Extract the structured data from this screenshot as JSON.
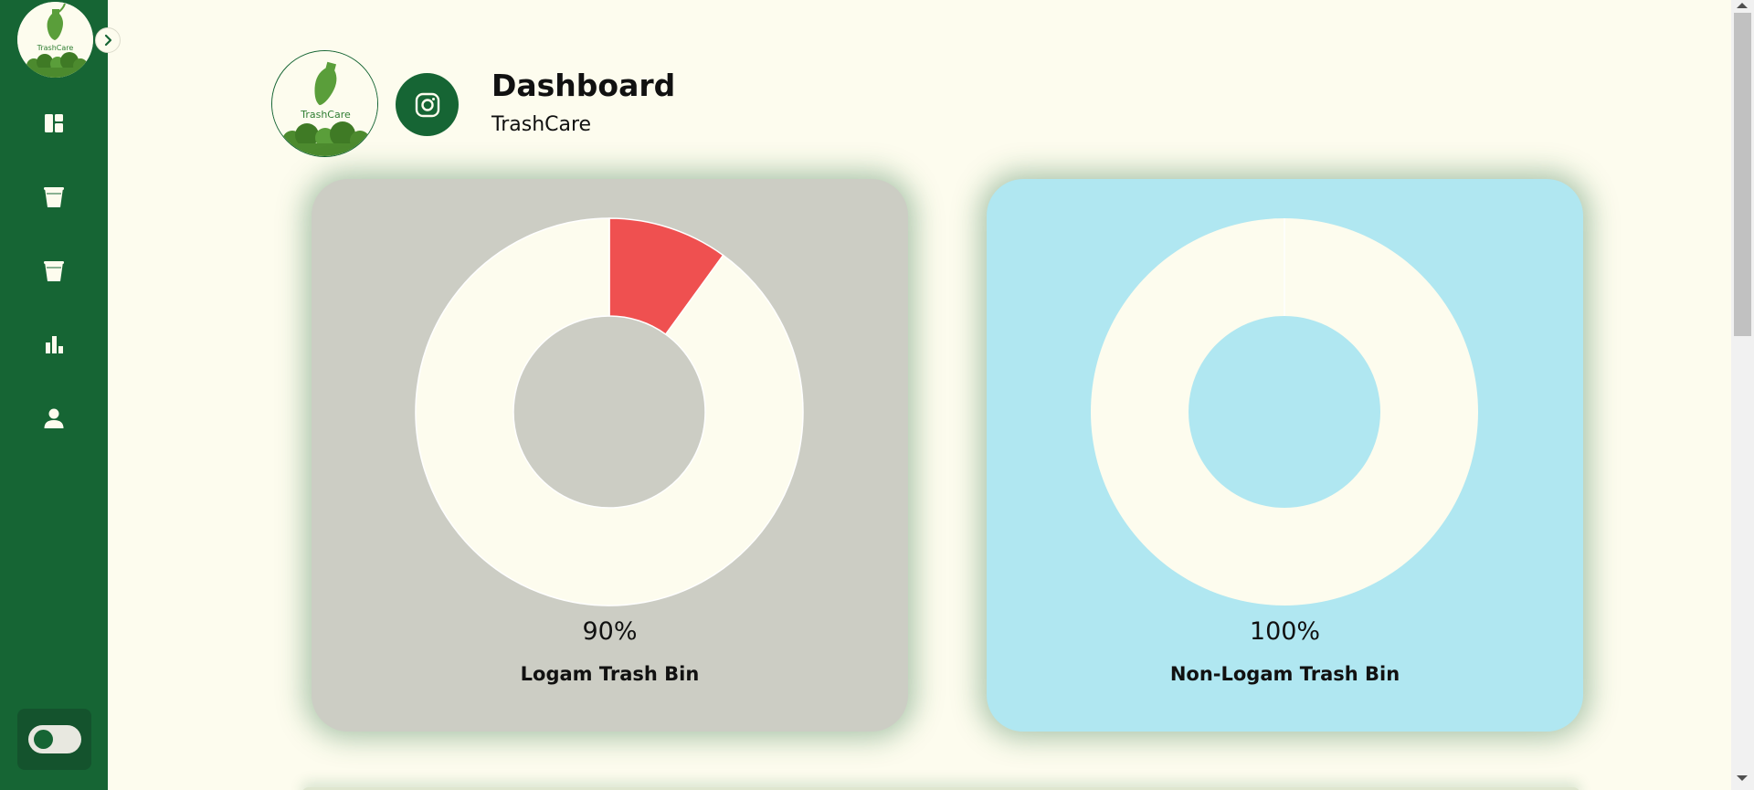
{
  "app": {
    "name": "TrashCare",
    "logo_text": "TrashCare"
  },
  "sidebar": {
    "items": [
      {
        "icon": "dashboard-icon"
      },
      {
        "icon": "trash-bin-icon"
      },
      {
        "icon": "trash-bin-icon"
      },
      {
        "icon": "bar-chart-icon"
      },
      {
        "icon": "user-icon"
      }
    ],
    "toggle": {
      "state": "off"
    }
  },
  "header": {
    "title": "Dashboard",
    "subtitle": "TrashCare",
    "social_icon": "instagram-icon"
  },
  "cards": [
    {
      "label": "Logam Trash Bin",
      "percent_text": "90%",
      "fill_fraction": 0.9,
      "background": "#cccdc4",
      "accent": "#ef5050"
    },
    {
      "label": "Non-Logam Trash Bin",
      "percent_text": "100%",
      "fill_fraction": 1.0,
      "background": "#b0e7f1",
      "accent": "#ef5050"
    }
  ],
  "colors": {
    "brand": "#166534",
    "background": "#fdfcee",
    "donut_fill": "#fdfcee",
    "donut_alert": "#ef5050"
  }
}
